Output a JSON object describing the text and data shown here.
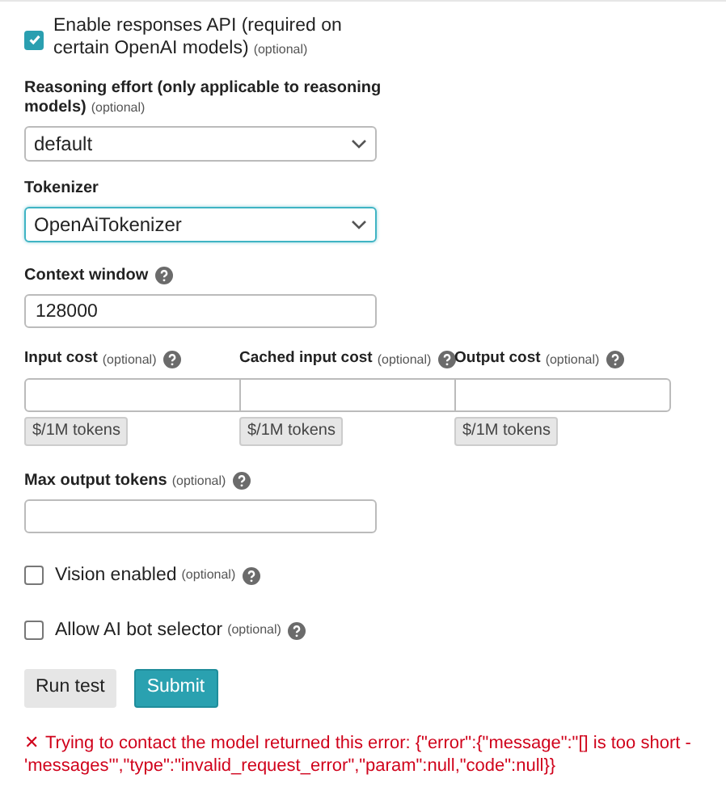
{
  "responses_api": {
    "label": "Enable responses API (required on certain OpenAI models)",
    "optional": "(optional)",
    "checked": true
  },
  "selects": [
    {
      "label": "Reasoning effort (only applicable to reasoning models)",
      "optional": "(optional)",
      "value": "default",
      "focused": false
    },
    {
      "label": "Tokenizer",
      "value": "OpenAiTokenizer",
      "focused": true
    }
  ],
  "context_window": {
    "label": "Context window",
    "value": "128000"
  },
  "costs": [
    {
      "label": "Input cost",
      "optional": "(optional)",
      "unit": "$/1M tokens"
    },
    {
      "label": "Cached input cost",
      "optional": "(optional)",
      "unit": "$/1M tokens"
    },
    {
      "label": "Output cost",
      "optional": "(optional)",
      "unit": "$/1M tokens"
    }
  ],
  "max_output_tokens": {
    "label": "Max output tokens",
    "optional": "(optional)"
  },
  "options": [
    {
      "label": "Vision enabled",
      "optional": "(optional)",
      "checked": false
    },
    {
      "label": "Allow AI bot selector",
      "optional": "(optional)",
      "checked": false
    }
  ],
  "buttons": [
    {
      "label": "Run test",
      "kind": "secondary"
    },
    {
      "label": "Submit",
      "kind": "primary"
    }
  ],
  "error": {
    "icon": "✕",
    "message": "Trying to contact the model returned this error: {\"error\":{\"message\":\"[] is too short - 'messages'\",\"type\":\"invalid_request_error\",\"param\":null,\"code\":null}}"
  }
}
